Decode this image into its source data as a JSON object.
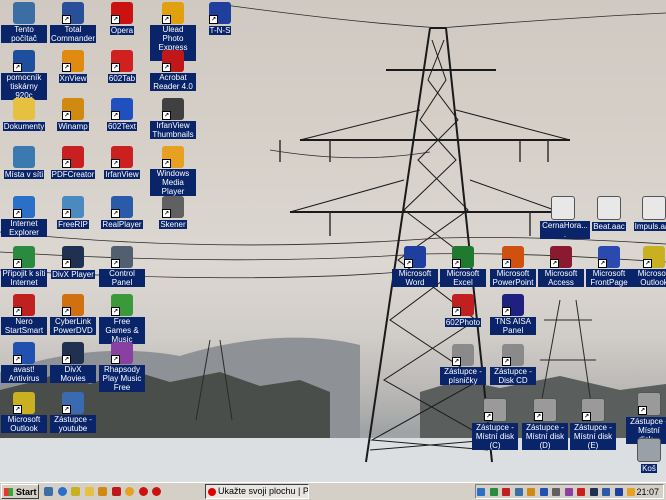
{
  "desktop": {
    "icons": [
      {
        "label": "Tento počítač",
        "icon": "computer-icon",
        "color": "#3a6ea5"
      },
      {
        "label": "Total Commander",
        "icon": "floppy-icon",
        "color": "#2a4f9a"
      },
      {
        "label": "Opera",
        "icon": "opera-icon",
        "color": "#cc1111"
      },
      {
        "label": "Ulead Photo Express 3....",
        "icon": "ulead-icon",
        "color": "#e0a010"
      },
      {
        "label": "T-N-S",
        "icon": "word-doc-icon",
        "color": "#1f3f9f"
      },
      {
        "label": "pomocník tiskárny 920c",
        "icon": "hp-icon",
        "color": "#1e4f9e"
      },
      {
        "label": "XnView",
        "icon": "xnview-icon",
        "color": "#e08a10"
      },
      {
        "label": "602Tab",
        "icon": "602tab-icon",
        "color": "#d02020"
      },
      {
        "label": "Acrobat Reader 4.0",
        "icon": "acrobat-icon",
        "color": "#c01818"
      },
      {
        "label": "Dokumenty",
        "icon": "folder-icon",
        "color": "#e8c040"
      },
      {
        "label": "Winamp",
        "icon": "winamp-icon",
        "color": "#d08a10"
      },
      {
        "label": "602Text",
        "icon": "602text-icon",
        "color": "#2050c0"
      },
      {
        "label": "IrfanView Thumbnails",
        "icon": "irfanview-panda-icon",
        "color": "#404040"
      },
      {
        "label": "Místa v síti",
        "icon": "network-icon",
        "color": "#3a7ab0"
      },
      {
        "label": "PDFCreator",
        "icon": "pdfcreator-icon",
        "color": "#c82020"
      },
      {
        "label": "IrfanView",
        "icon": "irfanview-icon",
        "color": "#cc2020"
      },
      {
        "label": "Windows Media Player",
        "icon": "media-player-icon",
        "color": "#e8a020"
      },
      {
        "label": "Internet Explorer",
        "icon": "ie-icon",
        "color": "#2a70c8"
      },
      {
        "label": "FreeRIP",
        "icon": "freerip-icon",
        "color": "#4a8ac0"
      },
      {
        "label": "RealPlayer",
        "icon": "realplayer-icon",
        "color": "#2a5aa8"
      },
      {
        "label": "Skener",
        "icon": "scanner-icon",
        "color": "#606060"
      },
      {
        "label": "Připojit k síti Internet",
        "icon": "globe-icon",
        "color": "#2a8a40"
      },
      {
        "label": "DivX Player",
        "icon": "divx-icon",
        "color": "#203050"
      },
      {
        "label": "Control Panel",
        "icon": "control-panel-icon",
        "color": "#506070"
      },
      {
        "label": "Nero StartSmart",
        "icon": "nero-icon",
        "color": "#c02020"
      },
      {
        "label": "CyberLink PowerDVD",
        "icon": "powerdvd-icon",
        "color": "#d07010"
      },
      {
        "label": "Free Games & Music",
        "icon": "games-icon",
        "color": "#3a9a3a"
      },
      {
        "label": "avast! Antivirus",
        "icon": "avast-icon",
        "color": "#2050b0"
      },
      {
        "label": "DivX Movies",
        "icon": "divx-movies-icon",
        "color": "#203050"
      },
      {
        "label": "Rhapsody Play Music Free",
        "icon": "rhapsody-icon",
        "color": "#8a40a0"
      },
      {
        "label": "Microsoft Outlook",
        "icon": "outlook-icon",
        "color": "#c8b020"
      },
      {
        "label": "Zástupce - youtube",
        "icon": "youtube-shortcut-icon",
        "color": "#3a6ab0"
      },
      {
        "label": "Microsoft Word",
        "icon": "word-icon",
        "color": "#1f3f9f"
      },
      {
        "label": "Microsoft Excel",
        "icon": "excel-icon",
        "color": "#1f7a30"
      },
      {
        "label": "Microsoft PowerPoint",
        "icon": "powerpoint-icon",
        "color": "#d05010"
      },
      {
        "label": "Microsoft Access",
        "icon": "access-icon",
        "color": "#8a1a30"
      },
      {
        "label": "Microsoft FrontPage",
        "icon": "frontpage-icon",
        "color": "#2a4ab0"
      },
      {
        "label": "Microsoft Outlook",
        "icon": "outlook-icon",
        "color": "#c8b020"
      },
      {
        "label": "602Photo",
        "icon": "602photo-icon",
        "color": "#c02020"
      },
      {
        "label": "TNS AISA Panel",
        "icon": "tns-panel-icon",
        "color": "#202080"
      },
      {
        "label": "Zástupce - písničky",
        "icon": "cd-shortcut-icon",
        "color": "#8a8a8a"
      },
      {
        "label": "Zástupce - Disk CD",
        "icon": "cd-icon",
        "color": "#8a8a8a"
      },
      {
        "label": "CernaHora....",
        "icon": "file-icon",
        "color": "#e8e8e8"
      },
      {
        "label": "Beat.aac",
        "icon": "file-icon",
        "color": "#e8e8e8"
      },
      {
        "label": "Impuls.aac",
        "icon": "file-icon",
        "color": "#e8e8e8"
      },
      {
        "label": "Zástupce - Místní disk (C)",
        "icon": "drive-icon",
        "color": "#9a9a9a"
      },
      {
        "label": "Zástupce - Místní disk (D)",
        "icon": "drive-icon",
        "color": "#9a9a9a"
      },
      {
        "label": "Zástupce - Místní disk (E)",
        "icon": "drive-icon",
        "color": "#9a9a9a"
      },
      {
        "label": "Zástupce - Místní disk...",
        "icon": "drive-icon",
        "color": "#9a9a9a"
      },
      {
        "label": "Koš",
        "icon": "recycle-bin-icon",
        "color": "#9aa0a8"
      }
    ]
  },
  "taskbar": {
    "start_label": "Start",
    "task_button": "Ukažte svoji plochu | P...",
    "clock": "21:07",
    "quick_launch": [
      "desktop-icon",
      "ie-icon",
      "outlook-icon",
      "folder-icon",
      "winamp-icon",
      "acrobat-icon",
      "media-player-icon",
      "opera-icon",
      "opera-icon"
    ]
  }
}
